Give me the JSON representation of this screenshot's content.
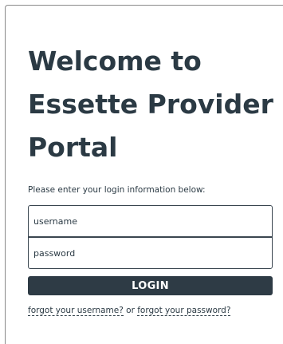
{
  "title": {
    "line1": "Welcome to",
    "line2": "Essette Provider",
    "line3": "Portal"
  },
  "instructions": "Please enter your login information below:",
  "form": {
    "username_placeholder": "username",
    "password_placeholder": "password",
    "login_label": "LOGIN"
  },
  "forgot": {
    "username_link": "forgot your username?",
    "separator": " or ",
    "password_link": "forgot your password?"
  }
}
